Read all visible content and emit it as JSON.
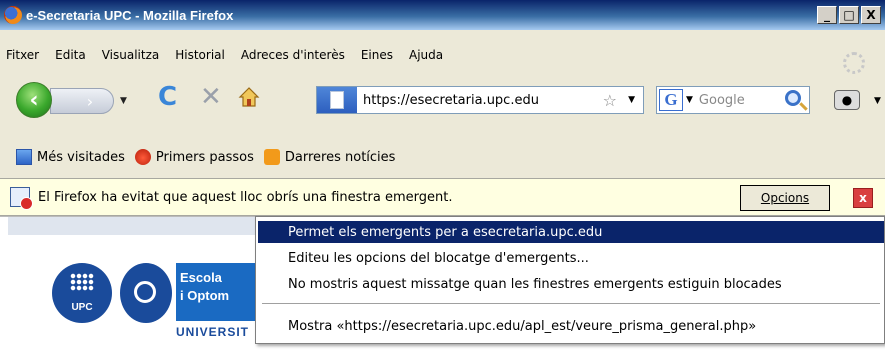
{
  "window": {
    "title": "e-Secretaria UPC - Mozilla Firefox",
    "controls": [
      "_",
      "□",
      "X"
    ]
  },
  "menubar": {
    "items": [
      "Fitxer",
      "Edita",
      "Visualitza",
      "Historial",
      "Adreces d'interès",
      "Eines",
      "Ajuda"
    ]
  },
  "navbar": {
    "url": "https://esecretaria.upc.edu",
    "search_placeholder": "Google"
  },
  "bookmarks": {
    "items": [
      "Més visitades",
      "Primers passos",
      "Darreres notícies"
    ]
  },
  "notification": {
    "message": "El Firefox ha evitat que aquest lloc obrís una finestra emergent.",
    "options_label": "Opcions",
    "close_label": "x"
  },
  "page": {
    "upc_label": "UPC",
    "school_line1": "Escola",
    "school_line2": "i Optom",
    "university_label": "UNIVERSIT"
  },
  "popup_menu": {
    "items": [
      "Permet els emergents per a esecretaria.upc.edu",
      "Editeu les opcions del blocatge d'emergents...",
      "No mostris aquest missatge quan les finestres emergents estiguin blocades",
      "Mostra «https://esecretaria.upc.edu/apl_est/veure_prisma_general.php»"
    ],
    "selected_index": 0
  }
}
